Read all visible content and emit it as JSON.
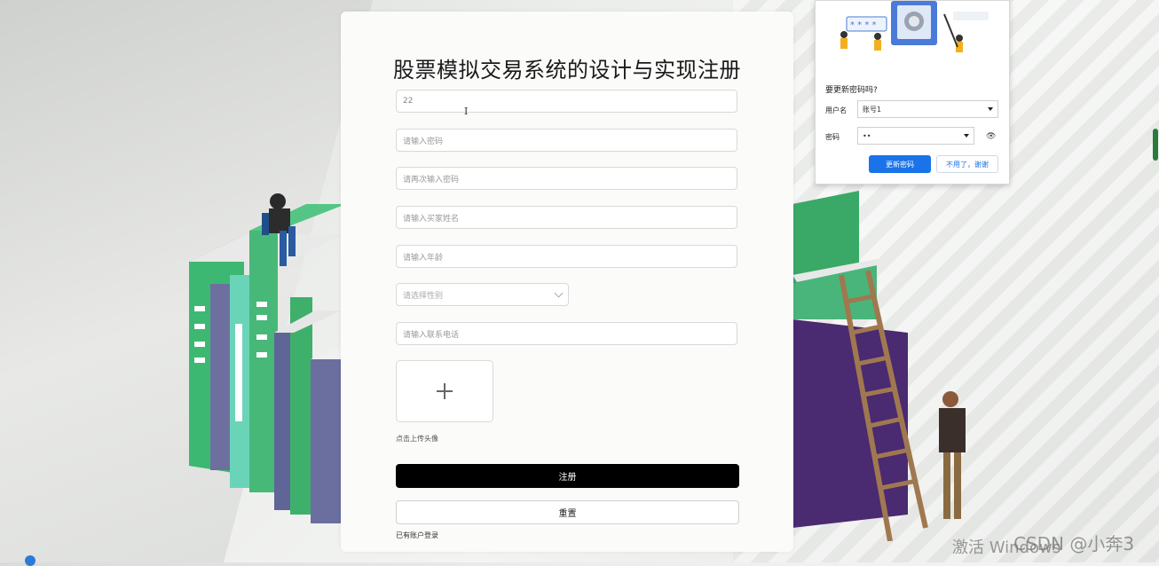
{
  "form": {
    "title": "股票模拟交易系统的设计与实现注册",
    "fields": {
      "account_value": "22",
      "password_placeholder": "请输入密码",
      "confirm_password_placeholder": "请再次输入密码",
      "name_placeholder": "请输入买家姓名",
      "age_placeholder": "请输入年龄",
      "gender_placeholder": "请选择性别",
      "phone_placeholder": "请输入联系电话"
    },
    "upload_hint": "点击上传头像",
    "register_label": "注册",
    "reset_label": "重置",
    "login_link": "已有账户登录"
  },
  "password_popup": {
    "question": "要更新密码吗?",
    "username_label": "用户名",
    "username_value": "账号1",
    "password_label": "密码",
    "password_value": "••",
    "update_label": "更新密码",
    "dismiss_label": "不用了，谢谢"
  },
  "watermark": {
    "activate": "激活 Windows",
    "credit": "CSDN @小奔3"
  },
  "colors": {
    "primary_button": "#000000",
    "update_button": "#1a73e8",
    "book_green": "#3aa866",
    "book_purple": "#6a6a9c"
  }
}
